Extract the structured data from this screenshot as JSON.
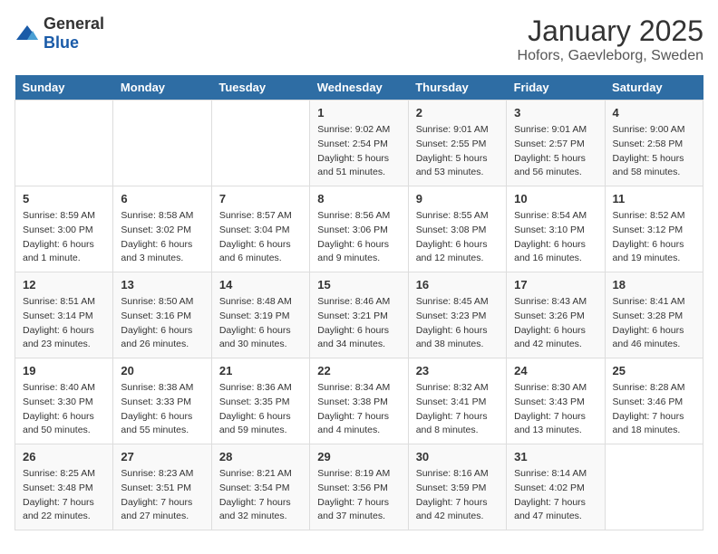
{
  "header": {
    "logo_general": "General",
    "logo_blue": "Blue",
    "title": "January 2025",
    "subtitle": "Hofors, Gaevleborg, Sweden"
  },
  "weekdays": [
    "Sunday",
    "Monday",
    "Tuesday",
    "Wednesday",
    "Thursday",
    "Friday",
    "Saturday"
  ],
  "weeks": [
    [
      {
        "day": "",
        "info": ""
      },
      {
        "day": "",
        "info": ""
      },
      {
        "day": "",
        "info": ""
      },
      {
        "day": "1",
        "info": "Sunrise: 9:02 AM\nSunset: 2:54 PM\nDaylight: 5 hours\nand 51 minutes."
      },
      {
        "day": "2",
        "info": "Sunrise: 9:01 AM\nSunset: 2:55 PM\nDaylight: 5 hours\nand 53 minutes."
      },
      {
        "day": "3",
        "info": "Sunrise: 9:01 AM\nSunset: 2:57 PM\nDaylight: 5 hours\nand 56 minutes."
      },
      {
        "day": "4",
        "info": "Sunrise: 9:00 AM\nSunset: 2:58 PM\nDaylight: 5 hours\nand 58 minutes."
      }
    ],
    [
      {
        "day": "5",
        "info": "Sunrise: 8:59 AM\nSunset: 3:00 PM\nDaylight: 6 hours\nand 1 minute."
      },
      {
        "day": "6",
        "info": "Sunrise: 8:58 AM\nSunset: 3:02 PM\nDaylight: 6 hours\nand 3 minutes."
      },
      {
        "day": "7",
        "info": "Sunrise: 8:57 AM\nSunset: 3:04 PM\nDaylight: 6 hours\nand 6 minutes."
      },
      {
        "day": "8",
        "info": "Sunrise: 8:56 AM\nSunset: 3:06 PM\nDaylight: 6 hours\nand 9 minutes."
      },
      {
        "day": "9",
        "info": "Sunrise: 8:55 AM\nSunset: 3:08 PM\nDaylight: 6 hours\nand 12 minutes."
      },
      {
        "day": "10",
        "info": "Sunrise: 8:54 AM\nSunset: 3:10 PM\nDaylight: 6 hours\nand 16 minutes."
      },
      {
        "day": "11",
        "info": "Sunrise: 8:52 AM\nSunset: 3:12 PM\nDaylight: 6 hours\nand 19 minutes."
      }
    ],
    [
      {
        "day": "12",
        "info": "Sunrise: 8:51 AM\nSunset: 3:14 PM\nDaylight: 6 hours\nand 23 minutes."
      },
      {
        "day": "13",
        "info": "Sunrise: 8:50 AM\nSunset: 3:16 PM\nDaylight: 6 hours\nand 26 minutes."
      },
      {
        "day": "14",
        "info": "Sunrise: 8:48 AM\nSunset: 3:19 PM\nDaylight: 6 hours\nand 30 minutes."
      },
      {
        "day": "15",
        "info": "Sunrise: 8:46 AM\nSunset: 3:21 PM\nDaylight: 6 hours\nand 34 minutes."
      },
      {
        "day": "16",
        "info": "Sunrise: 8:45 AM\nSunset: 3:23 PM\nDaylight: 6 hours\nand 38 minutes."
      },
      {
        "day": "17",
        "info": "Sunrise: 8:43 AM\nSunset: 3:26 PM\nDaylight: 6 hours\nand 42 minutes."
      },
      {
        "day": "18",
        "info": "Sunrise: 8:41 AM\nSunset: 3:28 PM\nDaylight: 6 hours\nand 46 minutes."
      }
    ],
    [
      {
        "day": "19",
        "info": "Sunrise: 8:40 AM\nSunset: 3:30 PM\nDaylight: 6 hours\nand 50 minutes."
      },
      {
        "day": "20",
        "info": "Sunrise: 8:38 AM\nSunset: 3:33 PM\nDaylight: 6 hours\nand 55 minutes."
      },
      {
        "day": "21",
        "info": "Sunrise: 8:36 AM\nSunset: 3:35 PM\nDaylight: 6 hours\nand 59 minutes."
      },
      {
        "day": "22",
        "info": "Sunrise: 8:34 AM\nSunset: 3:38 PM\nDaylight: 7 hours\nand 4 minutes."
      },
      {
        "day": "23",
        "info": "Sunrise: 8:32 AM\nSunset: 3:41 PM\nDaylight: 7 hours\nand 8 minutes."
      },
      {
        "day": "24",
        "info": "Sunrise: 8:30 AM\nSunset: 3:43 PM\nDaylight: 7 hours\nand 13 minutes."
      },
      {
        "day": "25",
        "info": "Sunrise: 8:28 AM\nSunset: 3:46 PM\nDaylight: 7 hours\nand 18 minutes."
      }
    ],
    [
      {
        "day": "26",
        "info": "Sunrise: 8:25 AM\nSunset: 3:48 PM\nDaylight: 7 hours\nand 22 minutes."
      },
      {
        "day": "27",
        "info": "Sunrise: 8:23 AM\nSunset: 3:51 PM\nDaylight: 7 hours\nand 27 minutes."
      },
      {
        "day": "28",
        "info": "Sunrise: 8:21 AM\nSunset: 3:54 PM\nDaylight: 7 hours\nand 32 minutes."
      },
      {
        "day": "29",
        "info": "Sunrise: 8:19 AM\nSunset: 3:56 PM\nDaylight: 7 hours\nand 37 minutes."
      },
      {
        "day": "30",
        "info": "Sunrise: 8:16 AM\nSunset: 3:59 PM\nDaylight: 7 hours\nand 42 minutes."
      },
      {
        "day": "31",
        "info": "Sunrise: 8:14 AM\nSunset: 4:02 PM\nDaylight: 7 hours\nand 47 minutes."
      },
      {
        "day": "",
        "info": ""
      }
    ]
  ]
}
